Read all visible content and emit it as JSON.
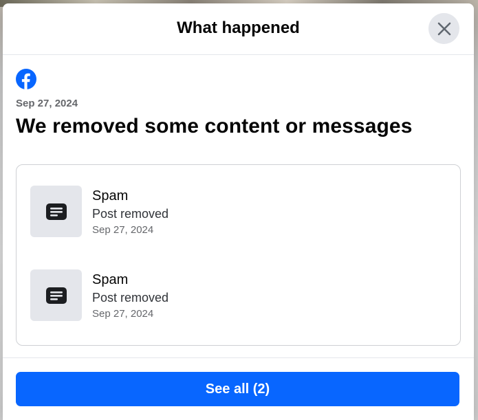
{
  "modal": {
    "title": "What happened",
    "close_icon": "close-icon"
  },
  "summary": {
    "logo_icon": "facebook-logo-icon",
    "date": "Sep 27, 2024",
    "headline": "We removed some content or messages"
  },
  "items": [
    {
      "icon": "post-icon",
      "title": "Spam",
      "status": "Post removed",
      "date": "Sep 27, 2024"
    },
    {
      "icon": "post-icon",
      "title": "Spam",
      "status": "Post removed",
      "date": "Sep 27, 2024"
    }
  ],
  "footer": {
    "button_label": "See all (2)"
  },
  "colors": {
    "primary": "#0866ff",
    "surface": "#ffffff",
    "muted_bg": "#e4e6eb",
    "text": "#050505",
    "secondary_text": "#65676b"
  }
}
